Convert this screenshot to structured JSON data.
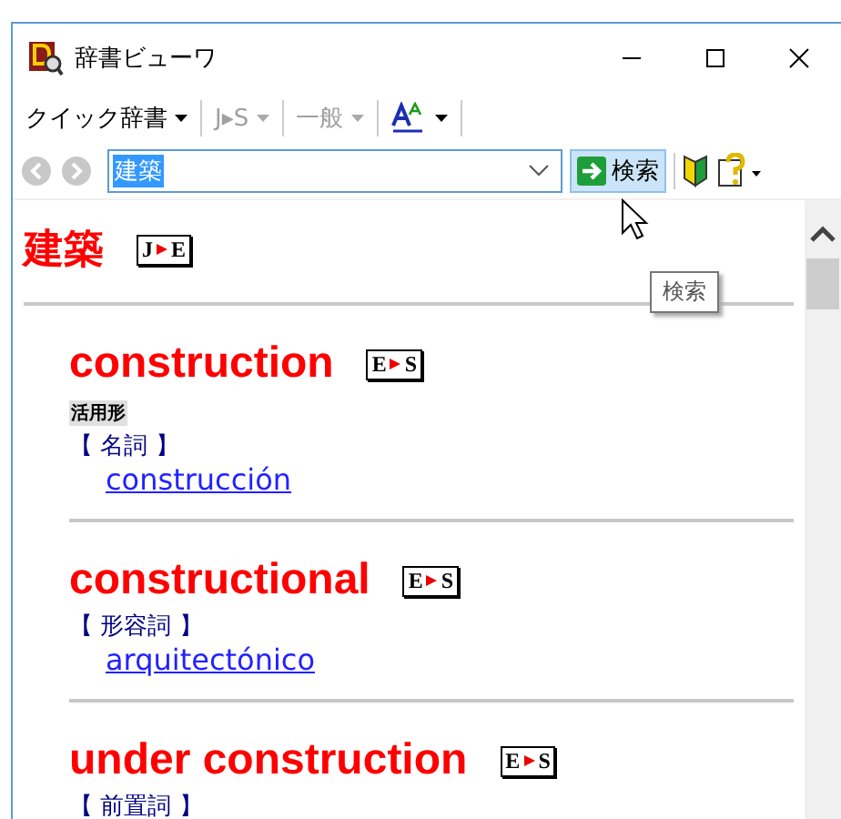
{
  "window": {
    "title": "辞書ビューワ"
  },
  "toolbar": [
    {
      "label": "クイック辞書",
      "disabled": false,
      "kind": "menu"
    },
    {
      "label": "J▸S",
      "disabled": true,
      "kind": "menu"
    },
    {
      "label": "一般",
      "disabled": true,
      "kind": "menu"
    },
    {
      "kind": "font",
      "disabled": false
    }
  ],
  "search": {
    "value": "建築",
    "button": "検索",
    "tooltip": "検索"
  },
  "entry": {
    "headword": "建築",
    "badge": {
      "from": "J",
      "to": "E"
    },
    "results": [
      {
        "headword": "construction",
        "badge": {
          "from": "E",
          "to": "S"
        },
        "tag": "活用形",
        "pos": "【 名詞 】",
        "translation": "construcción"
      },
      {
        "headword": "constructional",
        "badge": {
          "from": "E",
          "to": "S"
        },
        "pos": "【 形容詞 】",
        "translation": "arquitectónico"
      },
      {
        "headword": "under construction",
        "badge": {
          "from": "E",
          "to": "S"
        },
        "pos": "【 前置詞 】"
      }
    ]
  }
}
